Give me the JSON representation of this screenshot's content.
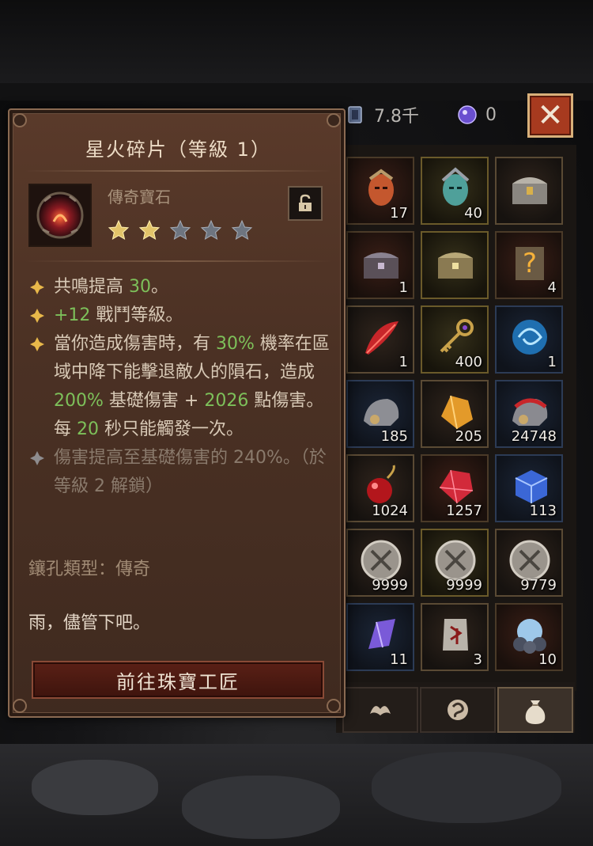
{
  "resources": {
    "currency_value": "7.8千",
    "orb_value": "0"
  },
  "close_label": "✕",
  "tooltip": {
    "title": "星火碎片（等級 1）",
    "gem_type": "傳奇寶石",
    "stars_total": 5,
    "stars_filled": 2,
    "effects": [
      {
        "pre": "共鳴提高 ",
        "hl": "30",
        "post": "。"
      },
      {
        "pre": "",
        "hl": "+12",
        "post": " 戰鬥等級。"
      }
    ],
    "effect3": {
      "a": "當你造成傷害時，有 ",
      "b": "30%",
      "c": " 機率在區域中降下能擊退敵人的隕石，造成 ",
      "d": "200%",
      "e": " 基礎傷害 + ",
      "f": "2026",
      "g": " 點傷害。每 ",
      "h": "20",
      "i": " 秒只能觸發一次。"
    },
    "locked_effect": "傷害提高至基礎傷害的 240%。（於等級 2 解鎖）",
    "socket_type": "鑲孔類型：傳奇",
    "flavor": "雨，儘管下吧。",
    "button": "前往珠寶工匠"
  },
  "inventory": [
    {
      "name": "legendary-mask-red",
      "count": "17"
    },
    {
      "name": "legendary-mask-teal",
      "count": "40"
    },
    {
      "name": "silver-chest",
      "count": ""
    },
    {
      "name": "ornate-chest-dark",
      "count": "1"
    },
    {
      "name": "ornate-chest-gold",
      "count": ""
    },
    {
      "name": "mystery-armor",
      "count": "4"
    },
    {
      "name": "red-feather",
      "count": "1"
    },
    {
      "name": "golden-key",
      "count": "400"
    },
    {
      "name": "blue-vortex",
      "count": "1"
    },
    {
      "name": "steel-pauldron",
      "count": "185"
    },
    {
      "name": "amber-crystal",
      "count": "205"
    },
    {
      "name": "red-pauldron",
      "count": "24748"
    },
    {
      "name": "red-orb-pendant",
      "count": "1024"
    },
    {
      "name": "ruby-shard",
      "count": "1257"
    },
    {
      "name": "blue-cube",
      "count": "113"
    },
    {
      "name": "silver-coin",
      "count": "9999"
    },
    {
      "name": "silver-coin",
      "count": "9999"
    },
    {
      "name": "silver-coin",
      "count": "9779"
    },
    {
      "name": "violet-crystal",
      "count": "11"
    },
    {
      "name": "rune-stone",
      "count": "3"
    },
    {
      "name": "pearl-cluster",
      "count": "10"
    }
  ],
  "colors": {
    "highlight_green": "#7dc05a",
    "close_button": "#a73a1f",
    "tooltip_bg": "#4b3124"
  }
}
